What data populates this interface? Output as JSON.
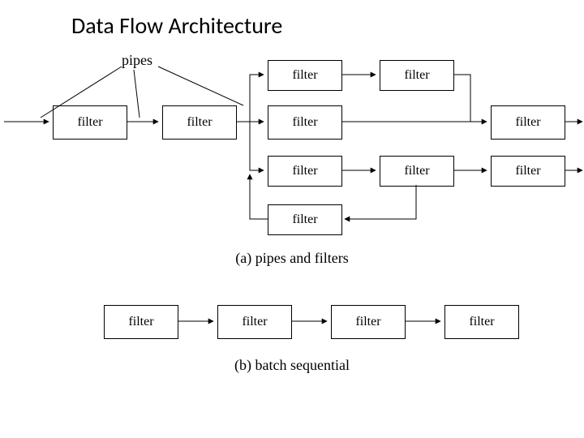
{
  "title": "Data Flow Architecture",
  "labels": {
    "pipes": "pipes",
    "caption_a": "(a)  pipes and filters",
    "caption_b": "(b)  batch sequential"
  },
  "filter": "filter"
}
